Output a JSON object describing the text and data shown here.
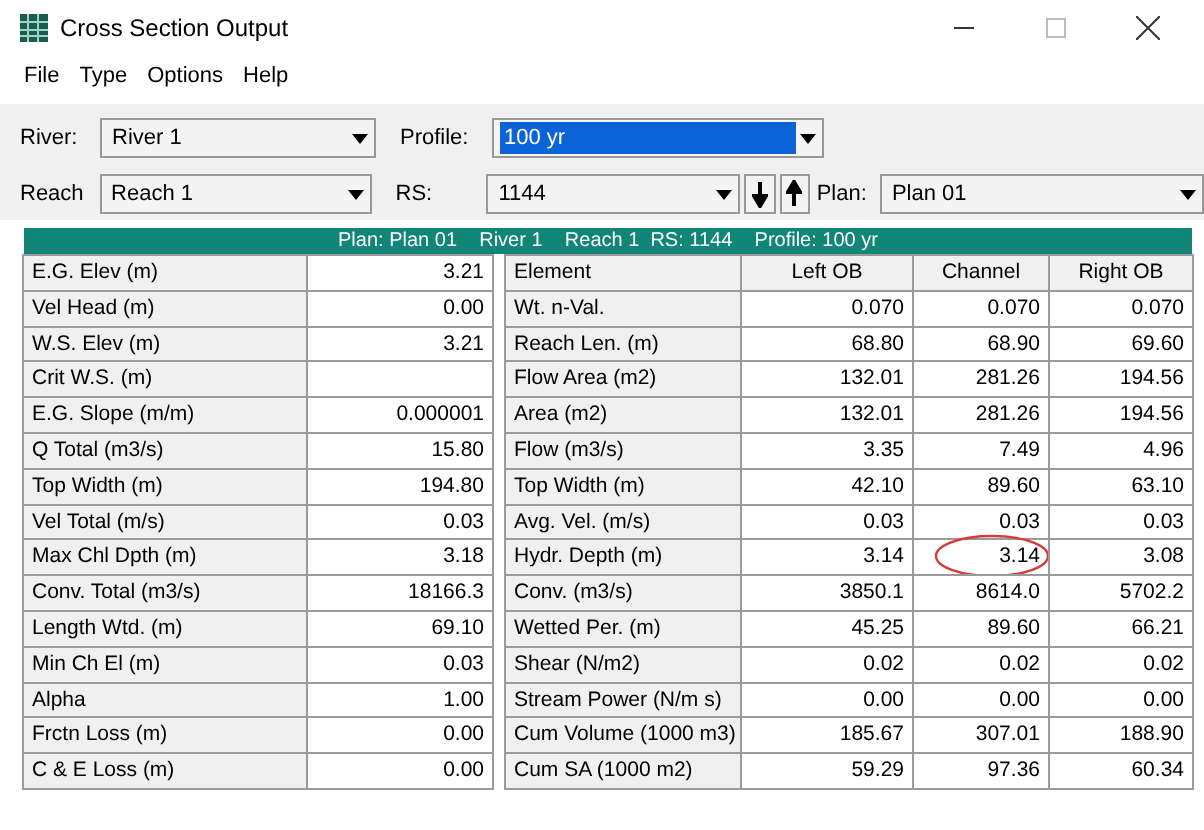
{
  "window": {
    "title": "Cross Section Output"
  },
  "menu": [
    "File",
    "Type",
    "Options",
    "Help"
  ],
  "selectors": {
    "river": {
      "label": "River:",
      "value": "River 1"
    },
    "profile": {
      "label": "Profile:",
      "value": "100 yr",
      "selected": true
    },
    "reach": {
      "label": "Reach",
      "value": "Reach 1"
    },
    "rs": {
      "label": "RS:",
      "value": "1144"
    },
    "plan": {
      "label": "Plan:",
      "value": "Plan 01"
    }
  },
  "banner": "Plan: Plan 01    River 1    Reach 1  RS: 1144    Profile: 100 yr",
  "left_table": [
    {
      "label": "E.G. Elev (m)",
      "value": "3.21"
    },
    {
      "label": "Vel Head (m)",
      "value": "0.00"
    },
    {
      "label": "W.S. Elev (m)",
      "value": "3.21"
    },
    {
      "label": "Crit W.S. (m)"
    },
    {
      "label": "E.G. Slope (m/m)",
      "value": "0.000001"
    },
    {
      "label": "Q Total (m3/s)",
      "value": "15.80"
    },
    {
      "label": "Top Width (m)",
      "value": "194.80"
    },
    {
      "label": "Vel Total (m/s)",
      "value": "0.03"
    },
    {
      "label": "Max Chl Dpth (m)",
      "value": "3.18"
    },
    {
      "label": "Conv. Total (m3/s)",
      "value": "18166.3"
    },
    {
      "label": "Length Wtd. (m)",
      "value": "69.10"
    },
    {
      "label": "Min Ch El (m)",
      "value": "0.03"
    },
    {
      "label": "Alpha",
      "value": "1.00"
    },
    {
      "label": "Frctn Loss (m)",
      "value": "0.00"
    },
    {
      "label": "C & E Loss (m)",
      "value": "0.00"
    }
  ],
  "right_table": {
    "columns": [
      "Element",
      "Left OB",
      "Channel",
      "Right OB"
    ],
    "rows": [
      {
        "label": "Wt. n-Val.",
        "values": [
          "0.070",
          "0.070",
          "0.070"
        ],
        "circled": false
      },
      {
        "label": "Reach Len. (m)",
        "values": [
          "68.80",
          "68.90",
          "69.60"
        ],
        "circled": false
      },
      {
        "label": "Flow Area (m2)",
        "values": [
          "132.01",
          "281.26",
          "194.56"
        ],
        "circled": false
      },
      {
        "label": "Area (m2)",
        "values": [
          "132.01",
          "281.26",
          "194.56"
        ],
        "circled": false
      },
      {
        "label": "Flow (m3/s)",
        "values": [
          "3.35",
          "7.49",
          "4.96"
        ],
        "circled": false
      },
      {
        "label": "Top Width (m)",
        "values": [
          "42.10",
          "89.60",
          "63.10"
        ],
        "circled": false
      },
      {
        "label": "Avg. Vel. (m/s)",
        "values": [
          "0.03",
          "0.03",
          "0.03"
        ],
        "circled": false
      },
      {
        "label": "Hydr. Depth (m)",
        "values": [
          "3.14",
          "3.14",
          "3.08"
        ],
        "circled": true
      },
      {
        "label": "Conv. (m3/s)",
        "values": [
          "3850.1",
          "8614.0",
          "5702.2"
        ],
        "circled": false
      },
      {
        "label": "Wetted Per. (m)",
        "values": [
          "45.25",
          "89.60",
          "66.21"
        ],
        "circled": false
      },
      {
        "label": "Shear (N/m2)",
        "values": [
          "0.02",
          "0.02",
          "0.02"
        ],
        "circled": false
      },
      {
        "label": "Stream Power (N/m s)",
        "values": [
          "0.00",
          "0.00",
          "0.00"
        ],
        "circled": false
      },
      {
        "label": "Cum Volume (1000 m3)",
        "values": [
          "185.67",
          "307.01",
          "188.90"
        ],
        "circled": false
      },
      {
        "label": "Cum SA (1000 m2)",
        "values": [
          "59.29",
          "97.36",
          "60.34"
        ],
        "circled": false
      }
    ]
  }
}
